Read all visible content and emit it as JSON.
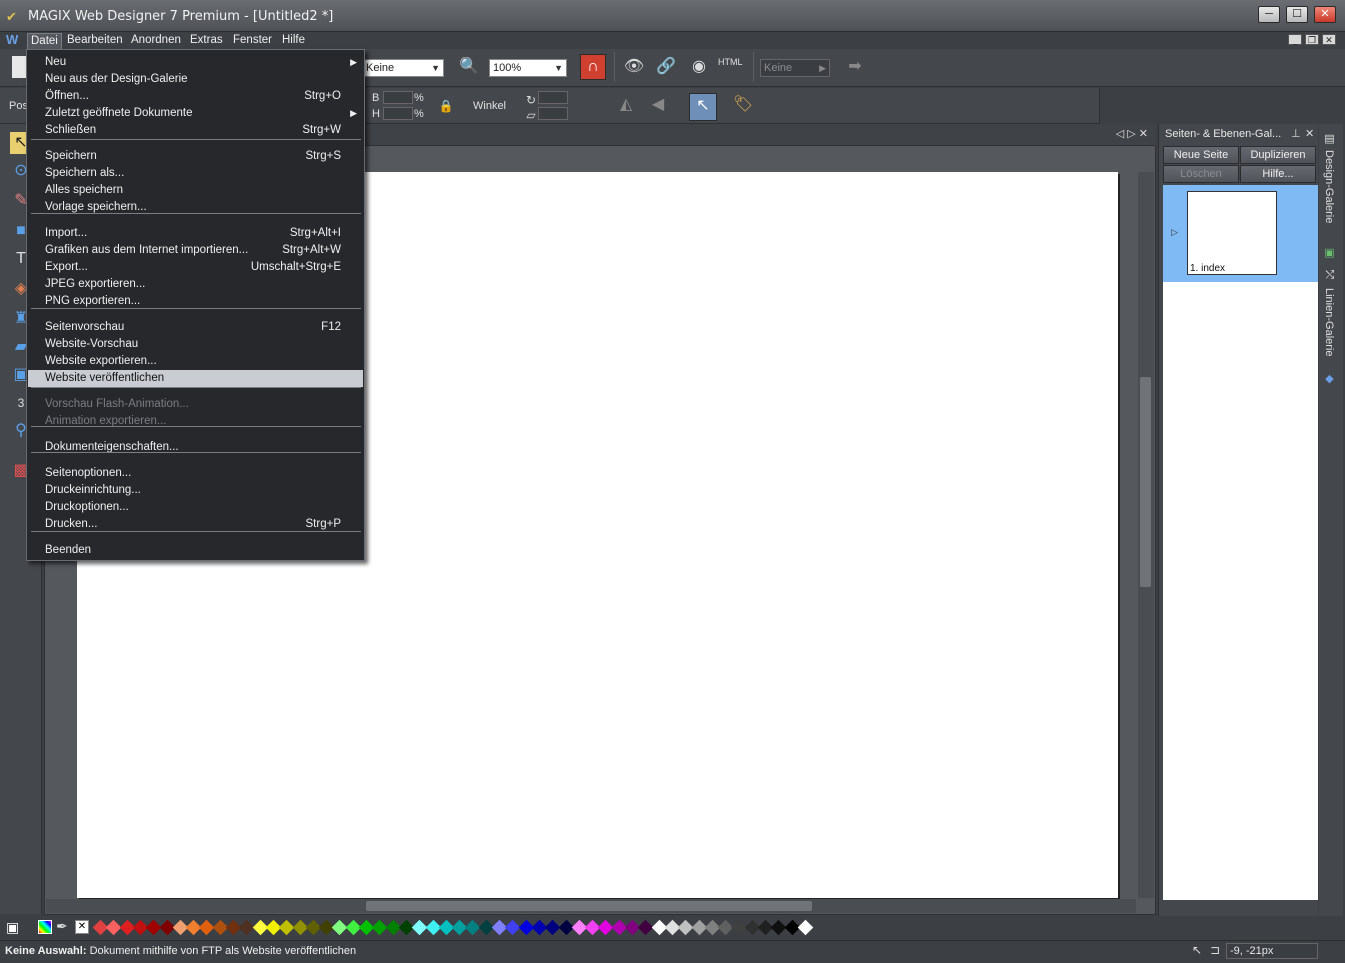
{
  "window": {
    "title": "MAGIX Web Designer 7 Premium - [Untitled2 *]",
    "min": "─",
    "max": "☐",
    "close": "✕"
  },
  "menubar": {
    "logo": "W",
    "items": [
      "Datei",
      "Bearbeiten",
      "Anordnen",
      "Extras",
      "Fenster",
      "Hilfe"
    ]
  },
  "toolbar1": {
    "combo_keine": "Keine",
    "zoom_value": "100%",
    "html_label": "HTML",
    "keine_disabled": "Keine"
  },
  "toolbar2": {
    "pos_label": "Pos",
    "b_label": "B",
    "h_label": "H",
    "pct": "%",
    "winkel_label": "Winkel"
  },
  "file_menu": {
    "items": [
      {
        "label": "Neu",
        "shortcut": "",
        "submenu": true
      },
      {
        "label": "Neu aus der Design-Galerie",
        "shortcut": ""
      },
      {
        "label": "Öffnen...",
        "shortcut": "Strg+O"
      },
      {
        "label": "Zuletzt geöffnete Dokumente",
        "shortcut": "",
        "submenu": true
      },
      {
        "label": "Schließen",
        "shortcut": "Strg+W"
      },
      {
        "label": "Speichern",
        "shortcut": "Strg+S"
      },
      {
        "label": "Speichern als...",
        "shortcut": ""
      },
      {
        "label": "Alles speichern",
        "shortcut": ""
      },
      {
        "label": "Vorlage speichern...",
        "shortcut": ""
      },
      {
        "label": "Import...",
        "shortcut": "Strg+Alt+I"
      },
      {
        "label": "Grafiken aus dem Internet importieren...",
        "shortcut": "Strg+Alt+W"
      },
      {
        "label": "Export...",
        "shortcut": "Umschalt+Strg+E"
      },
      {
        "label": "JPEG exportieren...",
        "shortcut": ""
      },
      {
        "label": "PNG exportieren...",
        "shortcut": ""
      },
      {
        "label": "Seitenvorschau",
        "shortcut": "F12"
      },
      {
        "label": "Website-Vorschau",
        "shortcut": ""
      },
      {
        "label": "Website exportieren...",
        "shortcut": ""
      },
      {
        "label": "Website veröffentlichen",
        "shortcut": "",
        "highlighted": true
      },
      {
        "label": "Vorschau Flash-Animation...",
        "shortcut": "",
        "disabled": true
      },
      {
        "label": "Animation exportieren...",
        "shortcut": "",
        "disabled": true
      },
      {
        "label": "Dokumenteigenschaften...",
        "shortcut": ""
      },
      {
        "label": "Seitenoptionen...",
        "shortcut": ""
      },
      {
        "label": "Druckeinrichtung...",
        "shortcut": ""
      },
      {
        "label": "Druckoptionen...",
        "shortcut": ""
      },
      {
        "label": "Drucken...",
        "shortcut": "Strg+P"
      },
      {
        "label": "Beenden",
        "shortcut": ""
      }
    ]
  },
  "right_panel": {
    "title": "Seiten- & Ebenen-Gal...",
    "btn_new_page": "Neue Seite",
    "btn_duplicate": "Duplizieren",
    "btn_delete": "Löschen",
    "btn_help": "Hilfe...",
    "page_name": "1. index",
    "tab_design": "Design-Galerie",
    "tab_lines": "Linien-Galerie"
  },
  "status": {
    "bold": "Keine Auswahl:",
    "text": "Dokument mithilfe von FTP als Website veröffentlichen",
    "coords": "-9, -21px"
  },
  "palette": [
    "#e04040",
    "#ff6060",
    "#e02020",
    "#c01010",
    "#a00000",
    "#800000",
    "#f0a070",
    "#f08030",
    "#e06010",
    "#b05010",
    "#703010",
    "#503020",
    "#ffff40",
    "#f0f000",
    "#c0c000",
    "#909000",
    "#606000",
    "#404000",
    "#80ff80",
    "#40f040",
    "#00c000",
    "#00a000",
    "#008000",
    "#004000",
    "#80ffff",
    "#40f0f0",
    "#00c0c0",
    "#00a0a0",
    "#008080",
    "#004040",
    "#8080ff",
    "#4040f0",
    "#0000e0",
    "#0000b0",
    "#000080",
    "#000040",
    "#ff80ff",
    "#f040f0",
    "#e000e0",
    "#b000b0",
    "#800080",
    "#400040",
    "#ffffff",
    "#e0e0e0",
    "#c0c0c0",
    "#a0a0a0",
    "#808080",
    "#606060",
    "#404040",
    "#303030",
    "#202020",
    "#101010",
    "#000000",
    "#ffffff"
  ]
}
